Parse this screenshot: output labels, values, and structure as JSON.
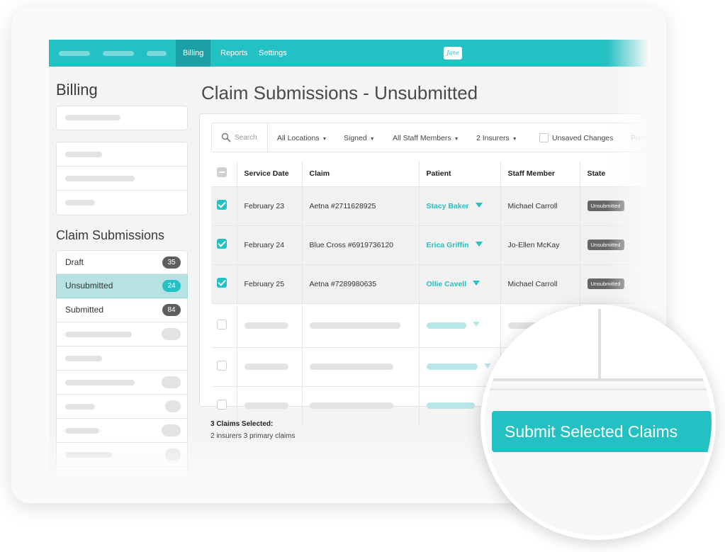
{
  "nav": {
    "links": [
      "Billing",
      "Reports",
      "Settings"
    ],
    "logo_text": "Jane"
  },
  "sidebar": {
    "title": "Billing",
    "claim_submissions_title": "Claim Submissions",
    "items": [
      {
        "label": "Draft",
        "count": "35"
      },
      {
        "label": "Unsubmitted",
        "count": "24"
      },
      {
        "label": "Submitted",
        "count": "84"
      }
    ]
  },
  "main": {
    "title": "Claim Submissions - Unsubmitted",
    "search_placeholder": "Search",
    "filters": [
      "All Locations",
      "Signed",
      "All Staff Members",
      "2 Insurers"
    ],
    "unsaved_changes_label": "Unsaved Changes",
    "truncated_filter": "Prim",
    "columns": [
      "Service Date",
      "Claim",
      "Patient",
      "Staff Member",
      "State"
    ],
    "rows": [
      {
        "date": "February 23",
        "claim": "Aetna #2711628925",
        "patient": "Stacy Baker",
        "staff": "Michael Carroll",
        "state": "Unsubmitted"
      },
      {
        "date": "February 24",
        "claim": "Blue Cross #6919736120",
        "patient": "Erica Griffin",
        "staff": "Jo-Ellen McKay",
        "state": "Unsubmitted"
      },
      {
        "date": "February 25",
        "claim": "Aetna #7289980635",
        "patient": "Ollie Cavell",
        "staff": "Michael Carroll",
        "state": "Unsubmitted"
      }
    ],
    "selected_title": "3 Claims Selected:",
    "selected_subtitle": "2 insurers 3 primary claims",
    "submit_label": "Submit Selected Claims"
  },
  "colors": {
    "accent": "#23c0c4",
    "nav_active": "#1b9fa5",
    "active_row": "#b6e2e3",
    "badge_dark": "#5e5e5e"
  }
}
